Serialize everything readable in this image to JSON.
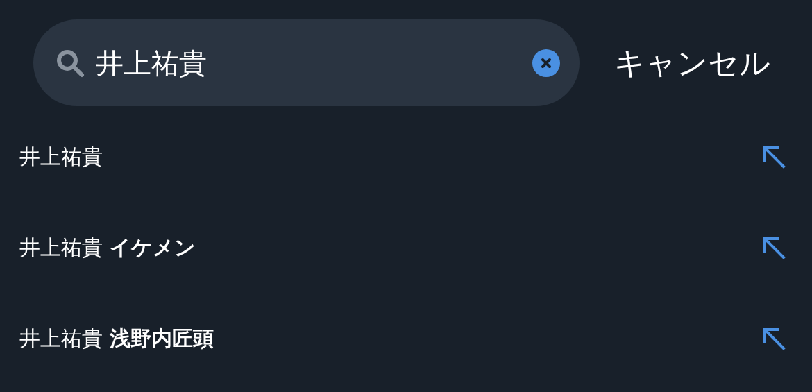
{
  "search": {
    "value": "井上祐貴"
  },
  "cancel": "キャンセル",
  "suggestions": [
    {
      "text": "井上祐貴"
    },
    {
      "text": "井上祐貴 **イケメン**"
    },
    {
      "text": "井上祐貴 **浅野内匠頭**"
    }
  ]
}
